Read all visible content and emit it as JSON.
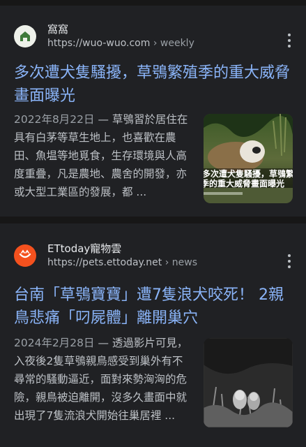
{
  "results": [
    {
      "site_name": "窩窩",
      "site_domain": "https://wuo-wuo.com",
      "site_path": " › weekly",
      "title": "多次遭犬隻騷擾，草鴞繁殖季的重大威脅畫面曝光",
      "date": "2022年8月22日",
      "snippet": " — 草鴞習於居住在具有白茅等草生地上，也喜歡在農田、魚塭等地覓食，生存環境與人高度重疊，凡是農地、農舍的開發，亦或大型工業區的發展，都 ...",
      "thumb_caption_line1": "多次遭犬隻騷擾，草鴞繁",
      "thumb_caption_line2": "季的重大威脅畫面曝光"
    },
    {
      "site_name": "ETtoday寵物雲",
      "site_domain": "https://pets.ettoday.net",
      "site_path": " › news",
      "title": "台南「草鴞寶寶」遭7隻浪犬咬死！ 2親鳥悲痛「叼屍體」離開巢穴",
      "date": "2024年2月28日",
      "snippet": " — 透過影片可見，入夜後2隻草鴞親鳥感受到巢外有不尋常的騷動逼近，面對來勢洶洶的危險，親鳥被迫離開，沒多久畫面中就出現了7隻流浪犬開始往巢居裡 ..."
    }
  ],
  "colors": {
    "background": "#202124",
    "separator": "#171717",
    "title_link": "#8ab4f8",
    "body_text": "#bdc1c6",
    "ettoday_orange": "#f4511e"
  },
  "icons": {
    "result1_favicon": "house-icon",
    "result2_favicon": "cat-face-icon",
    "menu": "more-vert-icon"
  }
}
